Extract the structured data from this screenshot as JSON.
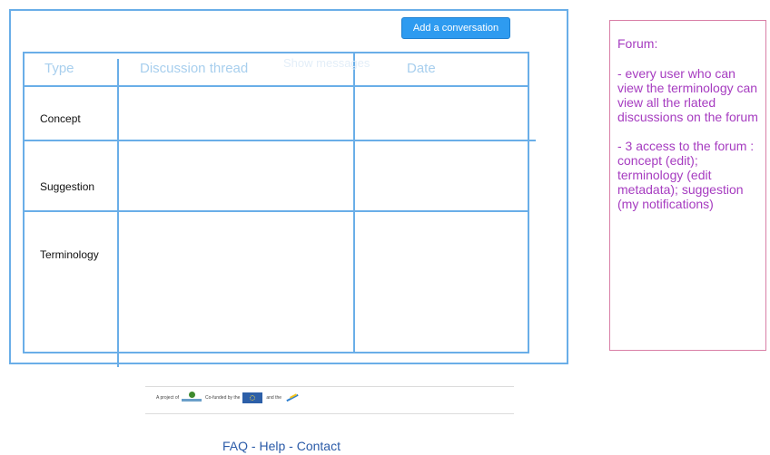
{
  "toolbar": {
    "add_conversation_label": "Add a conversation"
  },
  "table": {
    "headers": [
      "Type",
      "Discussion thread",
      "Date"
    ],
    "ghost_header": "Show messages",
    "rows": [
      "Concept",
      "Suggestion",
      "Terminology"
    ]
  },
  "note": {
    "title": "Forum:",
    "paragraphs": [
      "- every user who can view the terminology can view all the rlated discussions on the forum",
      "- 3 access to the forum : concept (edit); terminology (edit metadata); suggestion (my notifications)"
    ]
  },
  "footer": {
    "credits": [
      "A project of",
      "Co-funded by the",
      "and the"
    ],
    "links": [
      "FAQ",
      "Help",
      "Contact"
    ],
    "separator": " - "
  },
  "colors": {
    "frame": "#6aaee8",
    "button": "#2e9bf0",
    "note_text": "#a63cc0",
    "note_border": "#d97fa6",
    "links": "#2b5ba8"
  }
}
